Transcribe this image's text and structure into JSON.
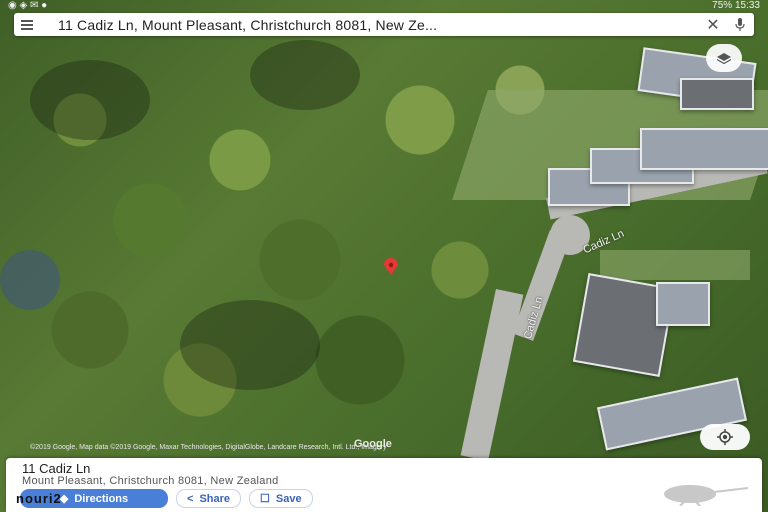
{
  "status_bar": {
    "right_text": "75%  15:33"
  },
  "search": {
    "query": "11 Cadiz Ln, Mount Pleasant, Christchurch 8081, New Ze..."
  },
  "map": {
    "street_labels": [
      "Cadiz Ln",
      "Cadiz Ln"
    ],
    "attribution": "©2019 Google, Map data ©2019 Google, Maxar Technologies, DigitalGlobe, Landcare Research, Intl. Ltd., Imagery",
    "logo_text": "Google",
    "pin_color": "#e53935"
  },
  "place": {
    "name": "11 Cadiz Ln",
    "address": "Mount Pleasant, Christchurch 8081, New Zealand",
    "actions": [
      {
        "label": "Directions",
        "icon": "directions-icon"
      },
      {
        "label": "Share",
        "icon": "share-icon"
      },
      {
        "label": "Save",
        "icon": "bookmark-icon"
      }
    ],
    "watermark": "nouri2"
  },
  "colors": {
    "accent": "#4a7fd8"
  }
}
